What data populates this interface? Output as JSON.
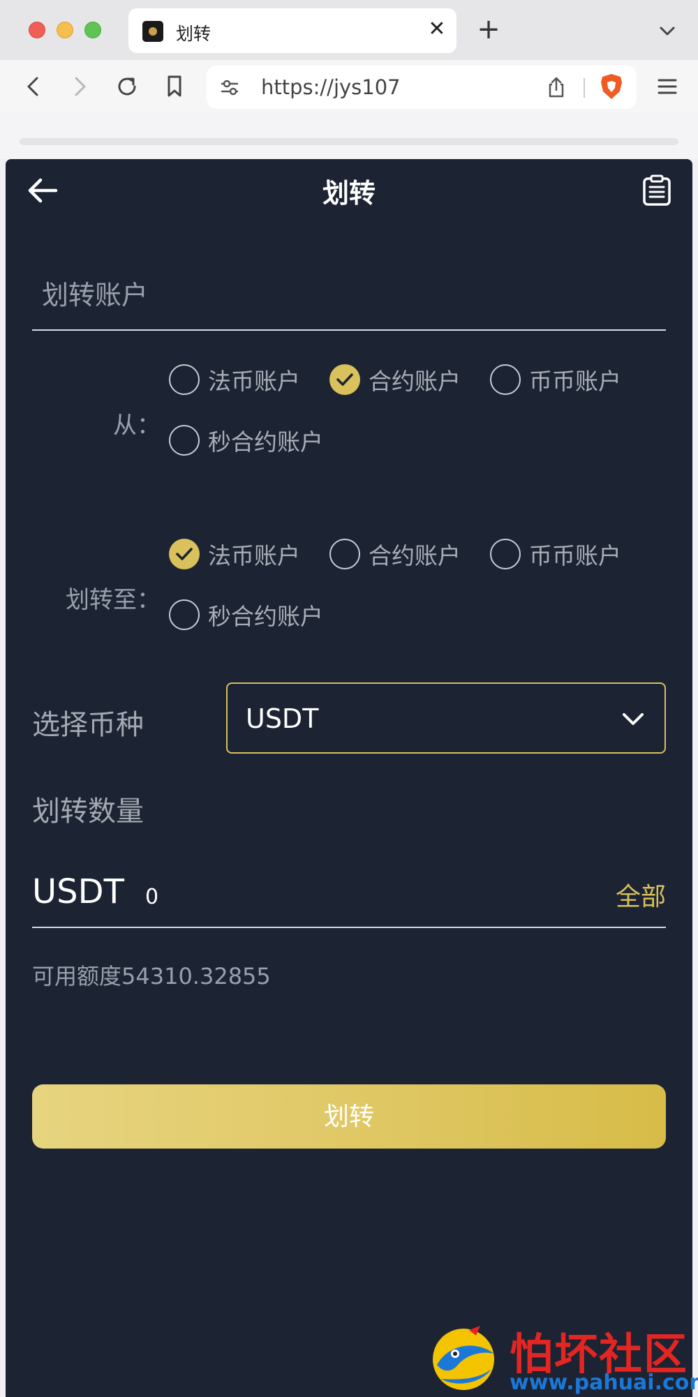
{
  "browser": {
    "tab_title": "划转",
    "tab_close": "✕",
    "new_tab": "+",
    "url": "https://jys107"
  },
  "header": {
    "title": "划转"
  },
  "transfer_account": {
    "title": "划转账户",
    "from_label": "从：",
    "from_options": [
      "法币账户",
      "合约账户",
      "币币账户",
      "秒合约账户"
    ],
    "from_selected": "合约账户",
    "to_label": "划转至：",
    "to_options": [
      "法币账户",
      "合约账户",
      "币币账户",
      "秒合约账户"
    ],
    "to_selected": "法币账户"
  },
  "coin": {
    "label": "选择币种",
    "selected": "USDT"
  },
  "amount": {
    "label": "划转数量",
    "currency": "USDT",
    "value": "0",
    "all_label": "全部",
    "available_text": "可用额度54310.32855"
  },
  "submit_label": "划转",
  "watermark": {
    "title": "怕坏社区",
    "url": "www.pahuai.com"
  },
  "colors": {
    "app_background": "#1c2333",
    "accent": "#d9c15c",
    "watermark_red": "#e32621",
    "watermark_blue": "#1c78d6"
  }
}
